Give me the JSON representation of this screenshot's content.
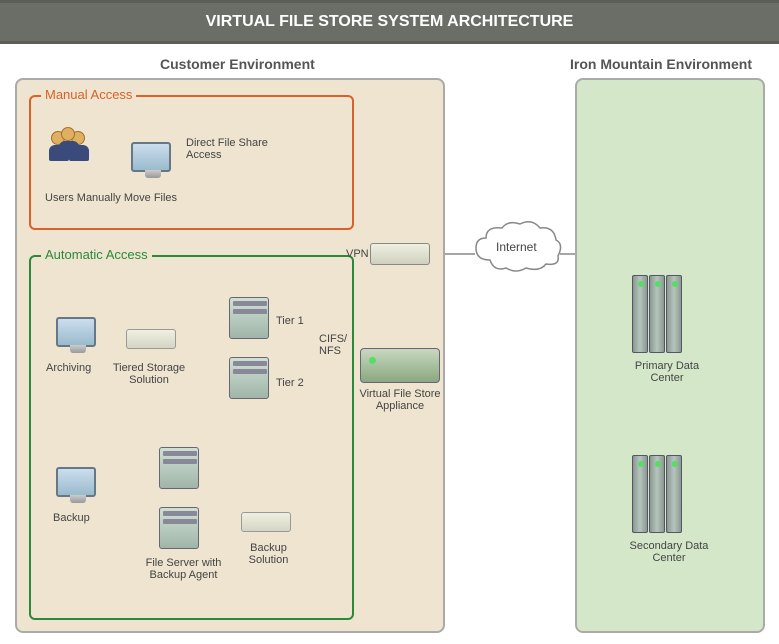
{
  "title": "VIRTUAL FILE STORE SYSTEM ARCHITECTURE",
  "sections": {
    "customer": "Customer Environment",
    "iron": "Iron Mountain Environment"
  },
  "manual": {
    "title": "Manual Access",
    "users_label": "Users Manually Move Files",
    "direct_label": "Direct File Share Access"
  },
  "auto": {
    "title": "Automatic Access",
    "archiving": "Archiving",
    "tiered": "Tiered Storage Solution",
    "tier1": "Tier 1",
    "tier2": "Tier 2",
    "backup": "Backup",
    "fileserver": "File Server with Backup Agent",
    "backup_solution": "Backup Solution"
  },
  "mid": {
    "vpn": "VPN",
    "cifs": "CIFS/ NFS",
    "appliance": "Virtual File Store Appliance",
    "internet": "Internet"
  },
  "iron_env": {
    "primary": "Primary Data Center",
    "secondary": "Secondary Data Center"
  }
}
